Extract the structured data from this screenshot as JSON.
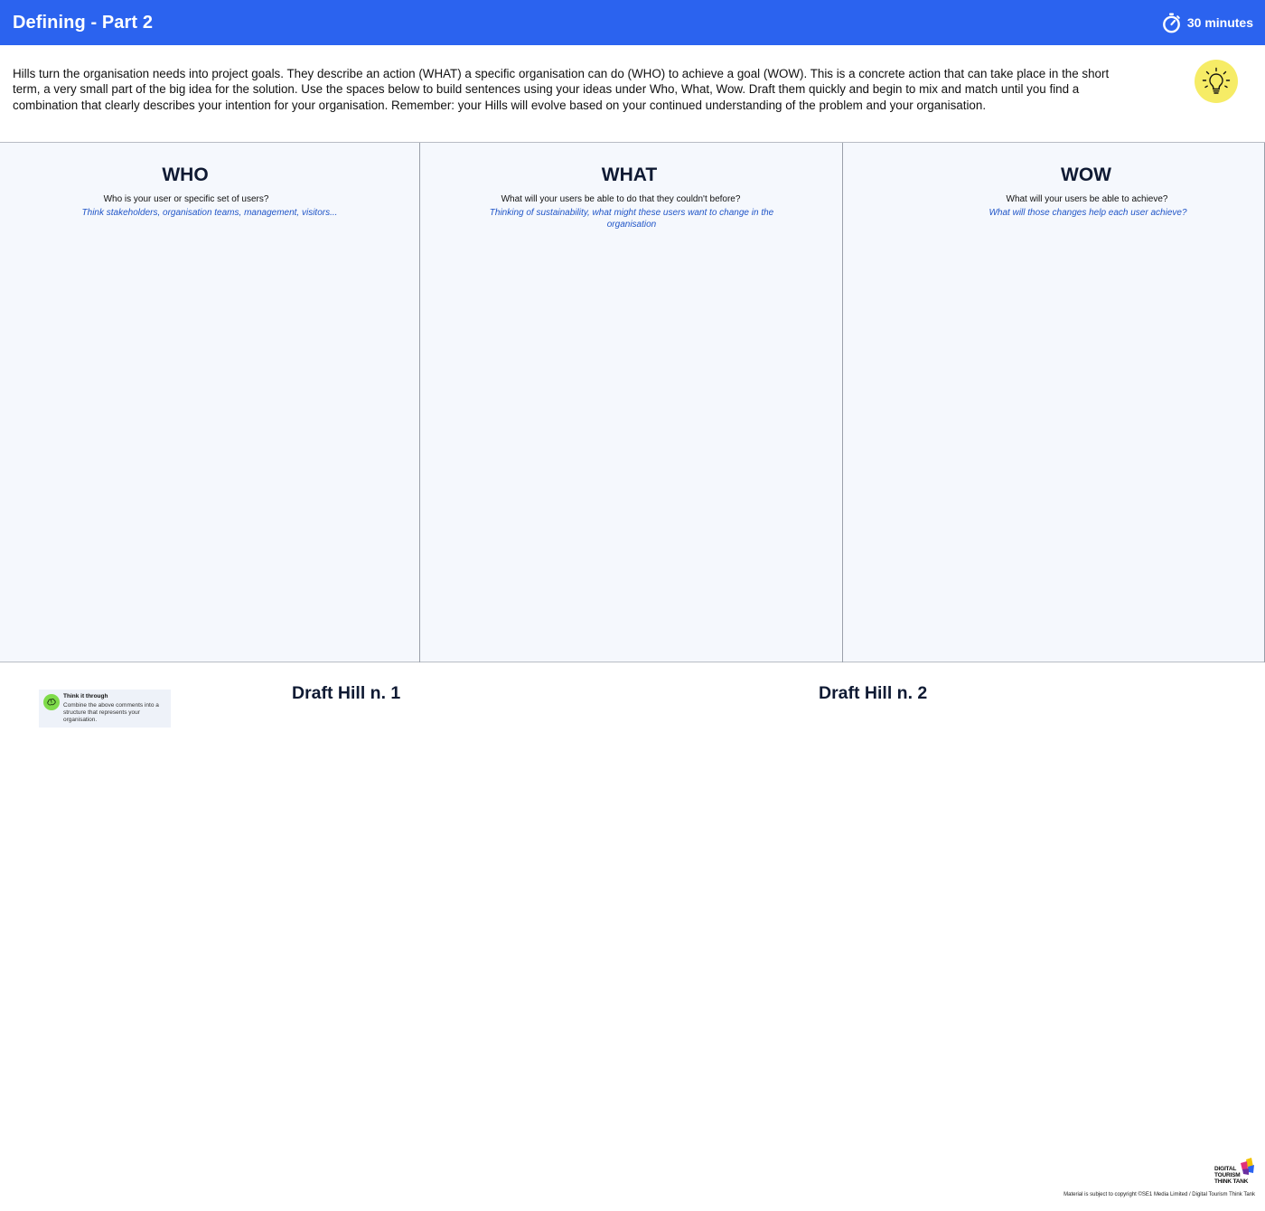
{
  "header": {
    "title": "Defining - Part 2",
    "timer_label": "30 minutes",
    "timer_icon": "stopwatch-icon",
    "background_color": "#2b63ef"
  },
  "intro": {
    "text": "Hills turn the organisation needs into project goals. They describe an action (WHAT) a specific organisation can do (WHO) to achieve a goal (WOW). This is a concrete action that can take place in the short term, a very small part of the big idea for the solution. Use the spaces below to build sentences using your ideas under Who, What, Wow. Draft them quickly and begin to mix and match until you find a combination that clearly describes your intention for your organisation. Remember: your Hills will evolve based on your continued understanding of the problem and your organisation.",
    "icon": "lightbulb-icon",
    "icon_color": "#f6ec66"
  },
  "columns": [
    {
      "title": "WHO",
      "question": "Who is your user or specific set of users?",
      "hint": "Think stakeholders, organisation teams, management, visitors..."
    },
    {
      "title": "WHAT",
      "question": "What will your users be able to do that they couldn't before?",
      "hint": "Thinking of sustainability, what might these users want to change in the organisation"
    },
    {
      "title": "WOW",
      "question": "What will your users be able to achieve?",
      "hint": "What will those changes help each user achieve?"
    }
  ],
  "think_card": {
    "title": "Think it through",
    "text": "Combine the above comments into a structure that represents your organisation.",
    "icon": "brain-icon",
    "icon_color": "#7fdb4a"
  },
  "drafts": [
    {
      "title": "Draft Hill n. 1"
    },
    {
      "title": "Draft Hill n. 2"
    }
  ],
  "logo": {
    "text": "DIGITAL TOURISM THINK TANK"
  },
  "footer": {
    "copyright": "Material is subject to copyright ©SE1 Media Limited / Digital Tourism Think Tank"
  }
}
